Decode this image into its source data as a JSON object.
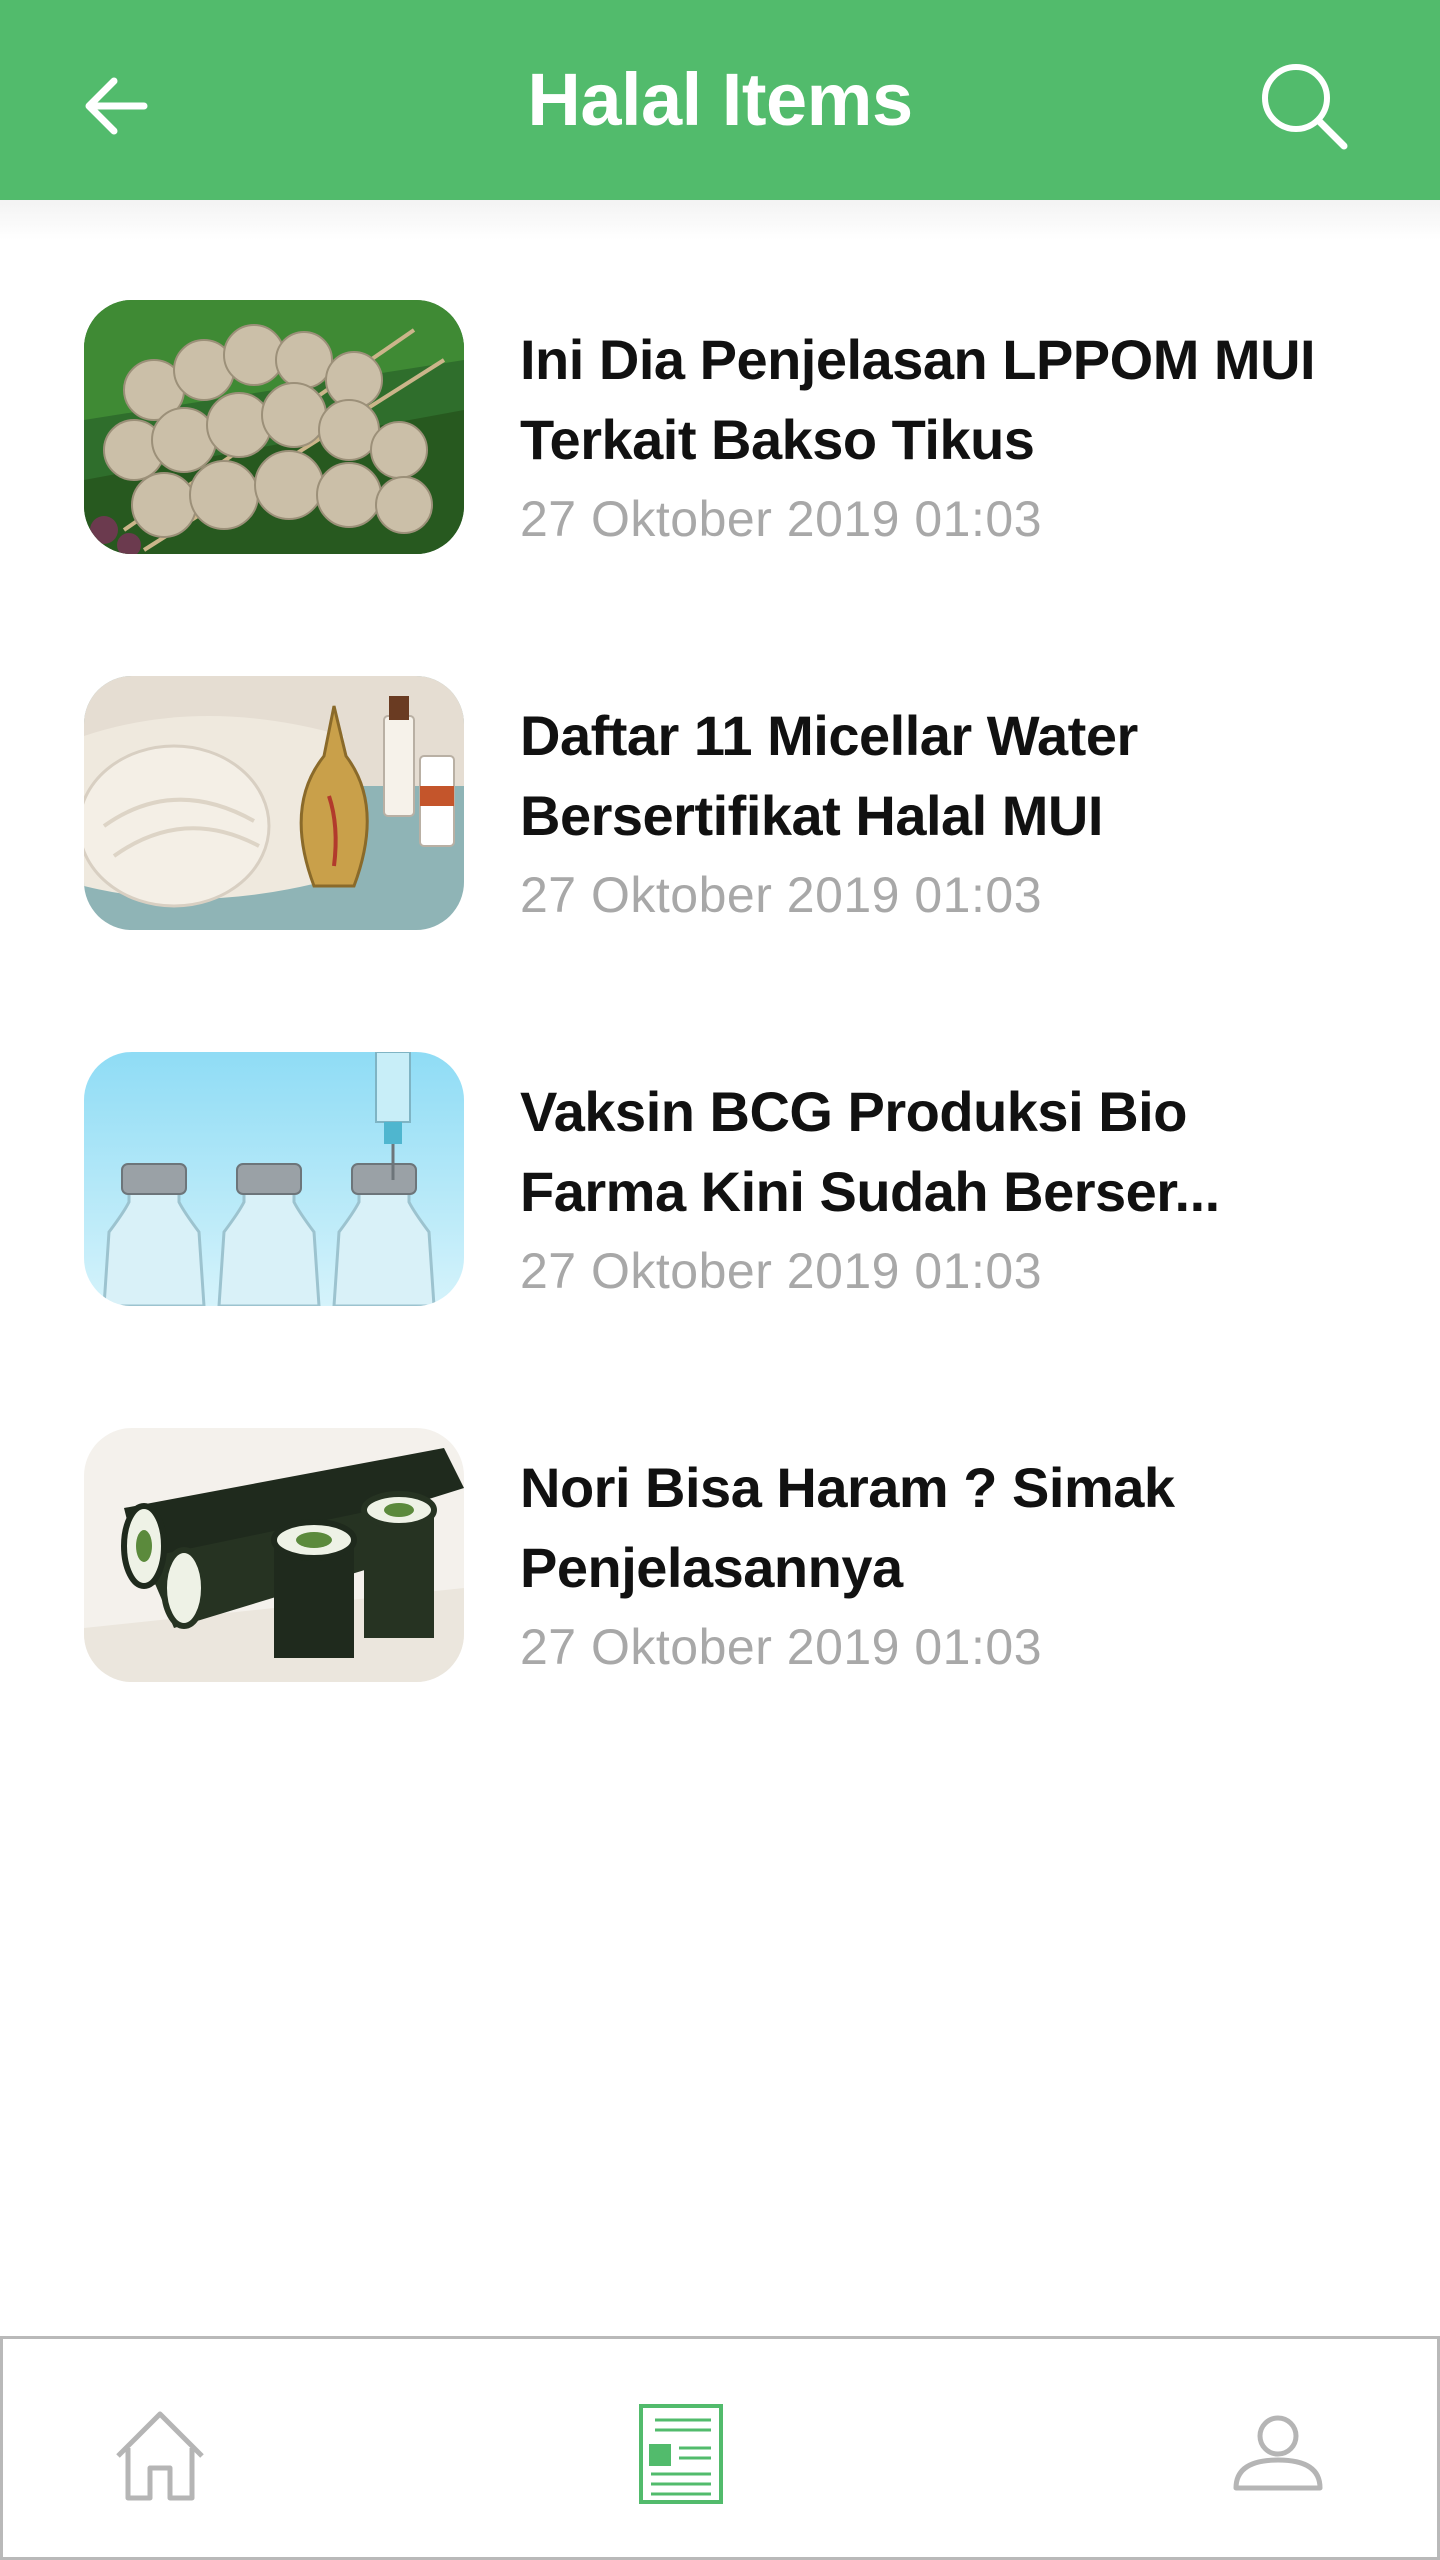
{
  "header": {
    "title": "Halal Items",
    "back_icon": "arrow-left-icon",
    "search_icon": "search-icon",
    "background_color": "#52bb6c"
  },
  "items": [
    {
      "title": "Ini Dia Penjelasan LPPOM MUI Terkait Bakso Tikus",
      "date": "27 Oktober 2019 01:03",
      "image": "meatball-skewers-photo"
    },
    {
      "title": "Daftar 11 Micellar Water Bersertifikat Halal MUI",
      "date": "27 Oktober 2019 01:03",
      "image": "towel-and-cosmetics-photo"
    },
    {
      "title": "Vaksin BCG Produksi Bio Farma Kini Sudah Berser...",
      "date": "27 Oktober 2019 01:03",
      "image": "vaccine-vials-photo"
    },
    {
      "title": "Nori Bisa Haram ? Simak Penjelasannya",
      "date": "27 Oktober 2019 01:03",
      "image": "nori-sushi-rolls-photo"
    }
  ],
  "bottom_nav": {
    "items": [
      {
        "icon": "home-icon",
        "active": false
      },
      {
        "icon": "news-icon",
        "active": true
      },
      {
        "icon": "profile-icon",
        "active": false
      }
    ],
    "active_color": "#52bb6c",
    "inactive_color": "#b5b5b5"
  }
}
